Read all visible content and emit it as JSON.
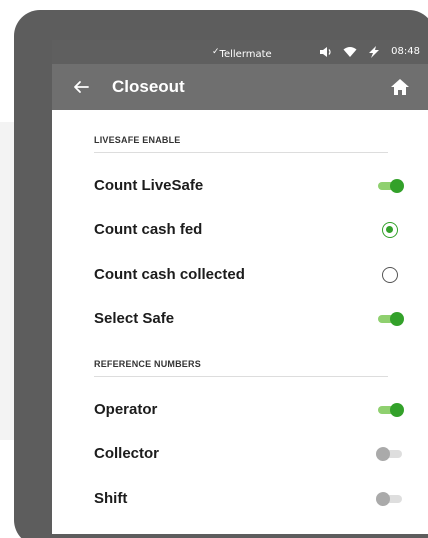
{
  "status_bar": {
    "brand_mark": "✓",
    "brand": "Tellermate",
    "time": "08:48",
    "icons": [
      "volume-icon",
      "wifi-icon",
      "battery-charging-icon"
    ]
  },
  "app_bar": {
    "title": "Closeout",
    "back_icon": "arrow-left-icon",
    "home_icon": "home-icon"
  },
  "sections": [
    {
      "heading": "LIVESAFE ENABLE",
      "items": [
        {
          "label": "Count LiveSafe",
          "control": "toggle",
          "value": true
        },
        {
          "label": "Count cash fed",
          "control": "radio",
          "value": true
        },
        {
          "label": "Count cash collected",
          "control": "radio",
          "value": false
        },
        {
          "label": "Select Safe",
          "control": "toggle",
          "value": true
        }
      ]
    },
    {
      "heading": "REFERENCE NUMBERS",
      "items": [
        {
          "label": "Operator",
          "control": "toggle",
          "value": true
        },
        {
          "label": "Collector",
          "control": "toggle",
          "value": false
        },
        {
          "label": "Shift",
          "control": "toggle",
          "value": false
        }
      ]
    }
  ],
  "colors": {
    "accent_green": "#33a12a",
    "accent_green_light": "#8fd06f",
    "app_bar": "#6f6f6f",
    "bezel": "#5d5d5d"
  }
}
